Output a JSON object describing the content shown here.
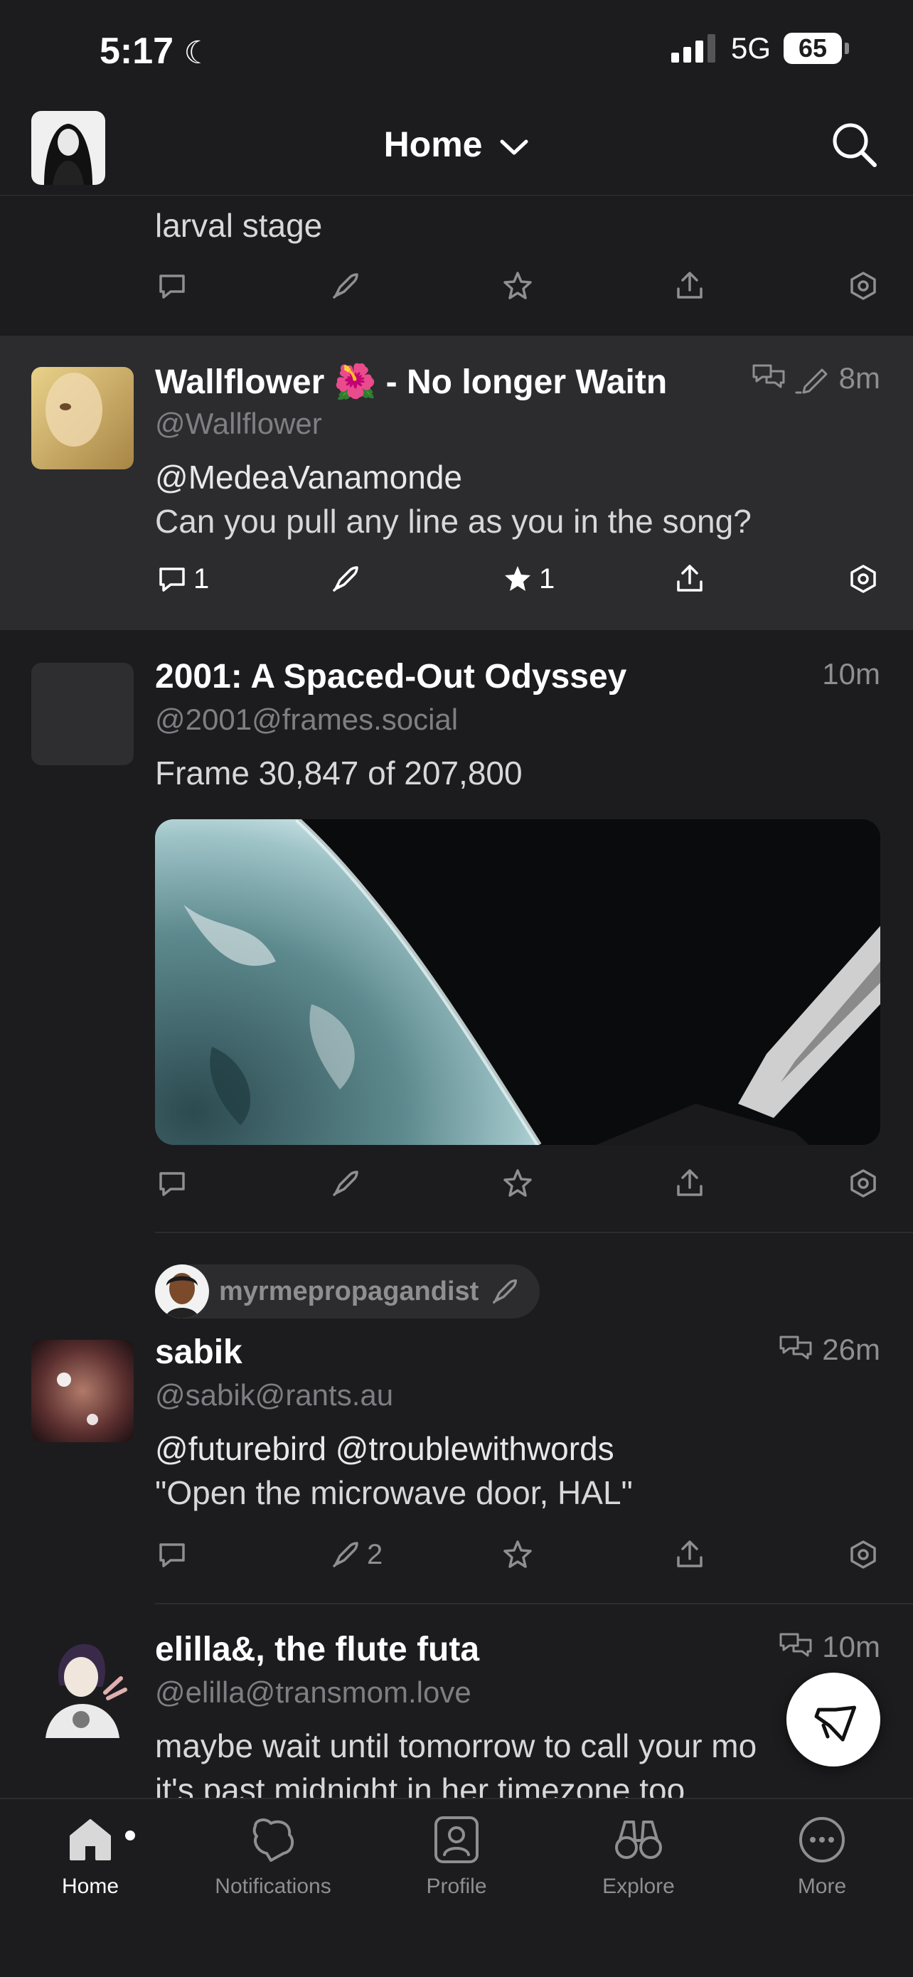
{
  "status_bar": {
    "time": "5:17",
    "network": "5G",
    "battery": "65"
  },
  "header": {
    "title": "Home"
  },
  "posts": [
    {
      "partial_text": "larval stage"
    },
    {
      "name": "Wallflower 🌺 - No longer Waitn",
      "handle": "@Wallflower",
      "time": "8m",
      "body_line1": "@MedeaVanamonde",
      "body_line2": "Can you pull any line as you in the song?",
      "replies": "1",
      "favorites": "1"
    },
    {
      "name": "2001: A Spaced-Out Odyssey",
      "handle": "@2001@frames.social",
      "time": "10m",
      "body_line1": "Frame 30,847 of 207,800"
    },
    {
      "boosted_by": "myrmepropagandist",
      "name": "sabik",
      "handle": "@sabik@rants.au",
      "time": "26m",
      "body_line1": "@futurebird @troublewithwords",
      "body_line2": "\"Open the microwave door, HAL\"",
      "boosts": "2"
    },
    {
      "name": "elilla&, the flute futa",
      "handle": "@elilla@transmom.love",
      "time": "10m",
      "body_line1": "maybe wait until tomorrow to call your mo",
      "body_line2": "it's past midnight in her timezone too"
    }
  ],
  "tabs": [
    {
      "label": "Home"
    },
    {
      "label": "Notifications"
    },
    {
      "label": "Profile"
    },
    {
      "label": "Explore"
    },
    {
      "label": "More"
    }
  ],
  "colors": {
    "background": "#1c1c1e",
    "highlight_row": "#2c2c2e",
    "muted": "#8e8e93"
  }
}
